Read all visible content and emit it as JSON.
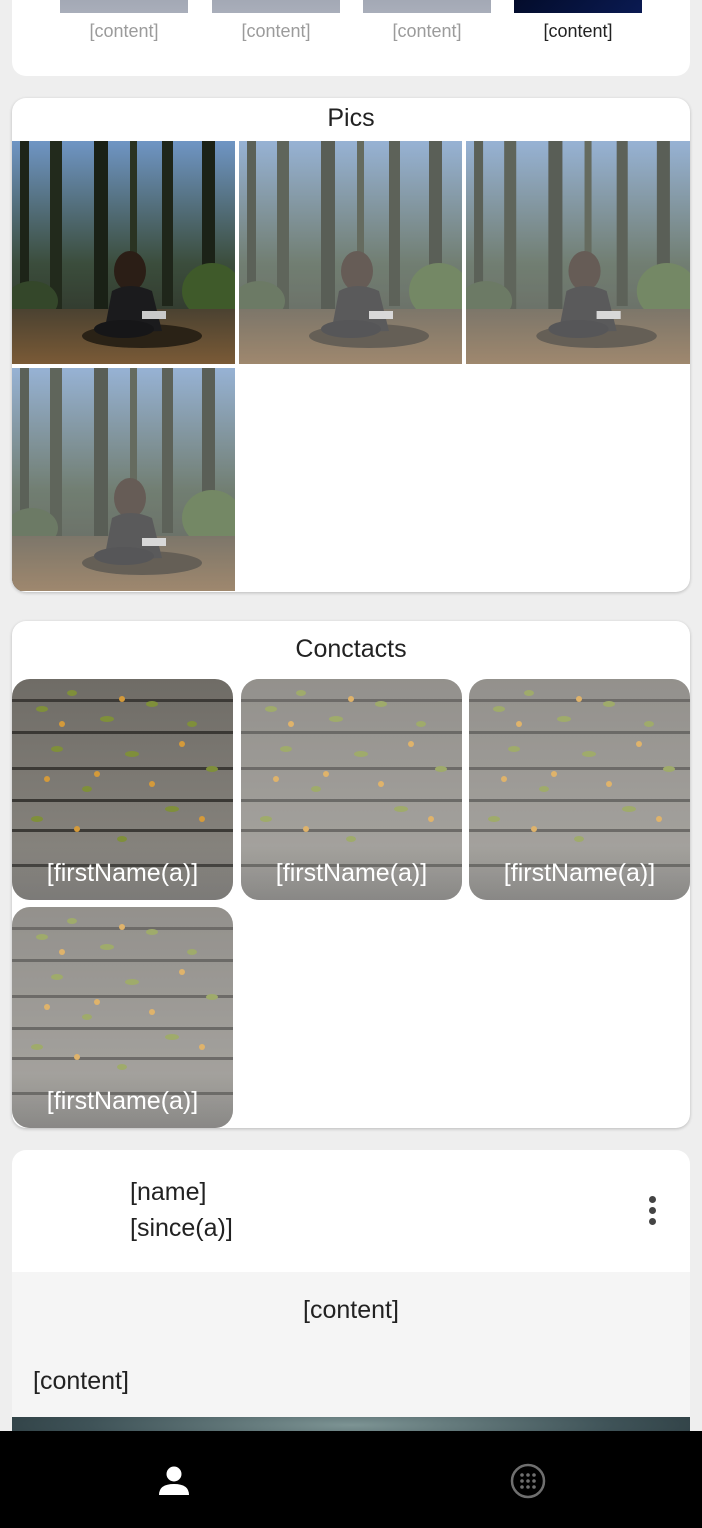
{
  "top_strip": {
    "items": [
      {
        "label": "[content]",
        "active": false
      },
      {
        "label": "[content]",
        "active": false
      },
      {
        "label": "[content]",
        "active": false
      },
      {
        "label": "[content]",
        "active": true
      }
    ]
  },
  "pics": {
    "title": "Pics",
    "count": 4
  },
  "contacts": {
    "title": "Conctacts",
    "items": [
      {
        "name": "[firstName(a)]"
      },
      {
        "name": "[firstName(a)]"
      },
      {
        "name": "[firstName(a)]"
      },
      {
        "name": "[firstName(a)]"
      }
    ]
  },
  "profile": {
    "name": "[name]",
    "since": "[since(a)]",
    "body_title": "[content]",
    "body_text": "[content]"
  },
  "bottom_nav": {
    "items": [
      {
        "icon": "person-icon",
        "active": true
      },
      {
        "icon": "apps-grid-icon",
        "active": false
      }
    ]
  },
  "colors": {
    "background": "#eeeeee",
    "card": "#ffffff",
    "nav": "#000000",
    "muted_text": "#9b9b9b"
  }
}
